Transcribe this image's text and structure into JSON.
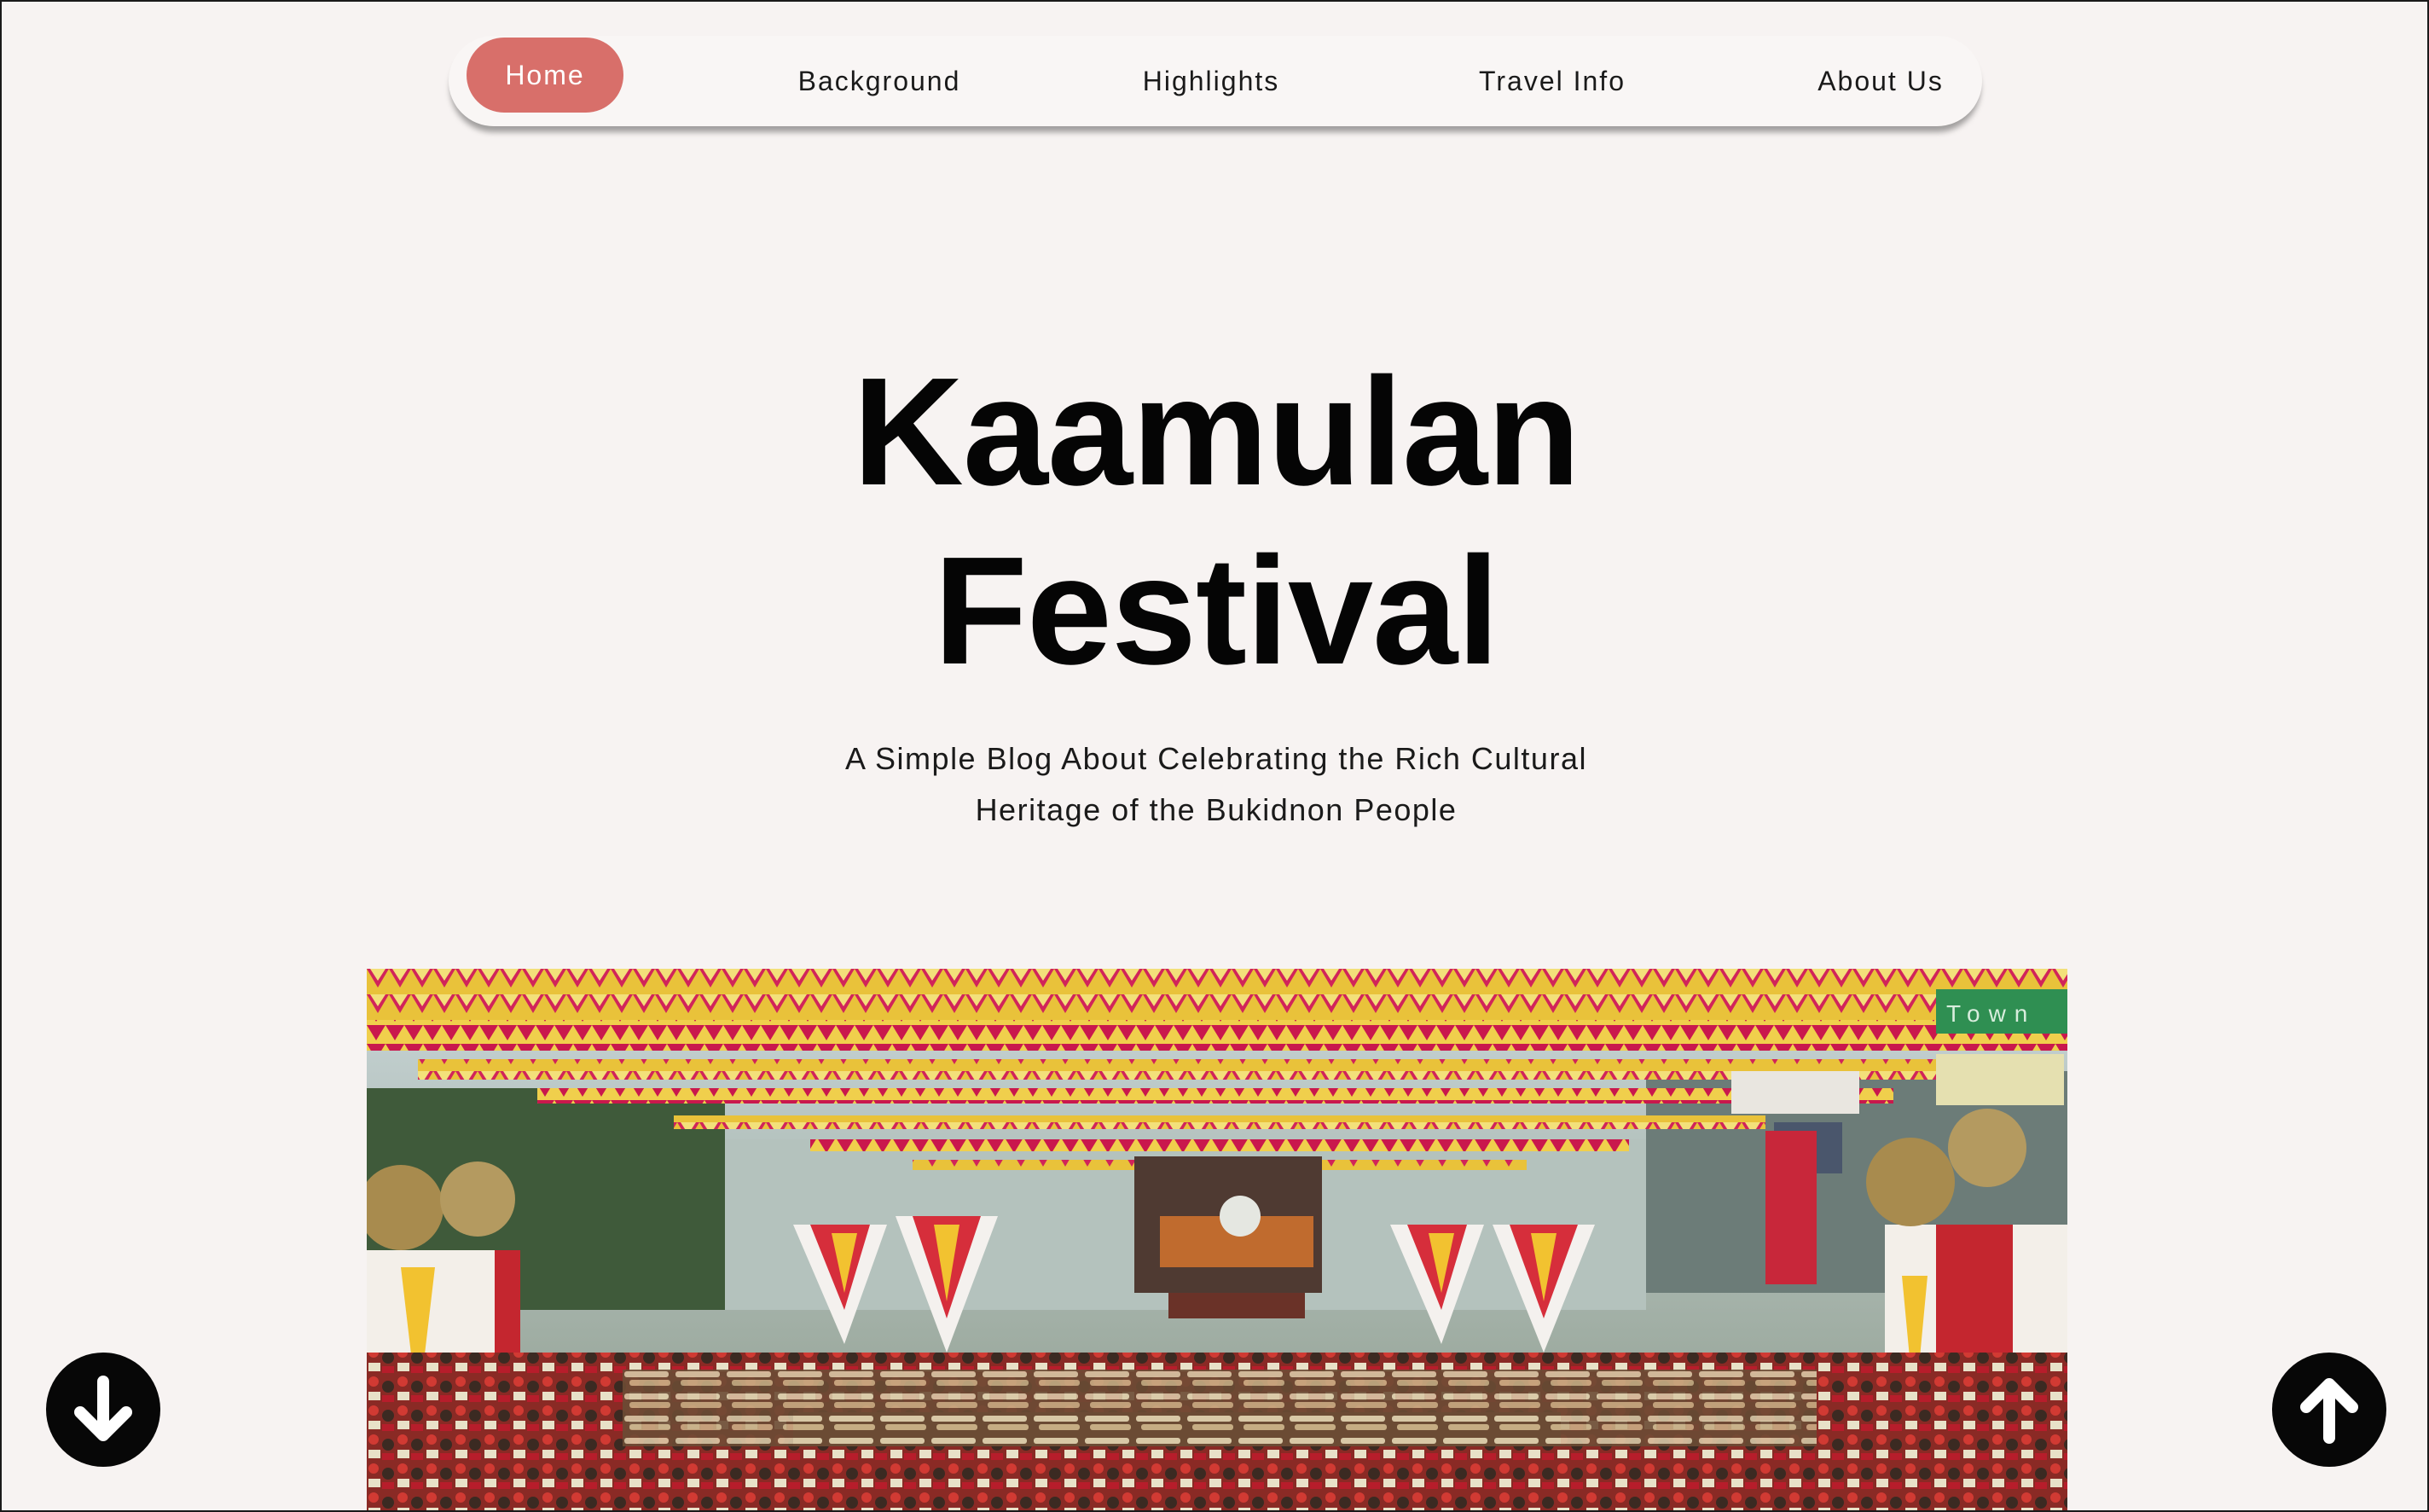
{
  "nav": {
    "items": [
      {
        "label": "Home",
        "active": true
      },
      {
        "label": "Background",
        "active": false
      },
      {
        "label": "Highlights",
        "active": false
      },
      {
        "label": "Travel Info",
        "active": false
      },
      {
        "label": "About Us",
        "active": false
      }
    ]
  },
  "hero": {
    "title_line1": "Kaamulan",
    "title_line2": "Festival",
    "subtitle_line1": "A Simple Blog About Celebrating the Rich Cultural",
    "subtitle_line2": "Heritage of the Bukidnon People"
  },
  "photo": {
    "sign_text": "Town"
  },
  "buttons": {
    "scroll_down_icon": "arrow-down-circle-icon",
    "scroll_up_icon": "arrow-up-circle-icon"
  },
  "colors": {
    "accent": "#d86f6a",
    "background": "#f7f3f2",
    "text": "#050505",
    "fab": "#070707"
  }
}
